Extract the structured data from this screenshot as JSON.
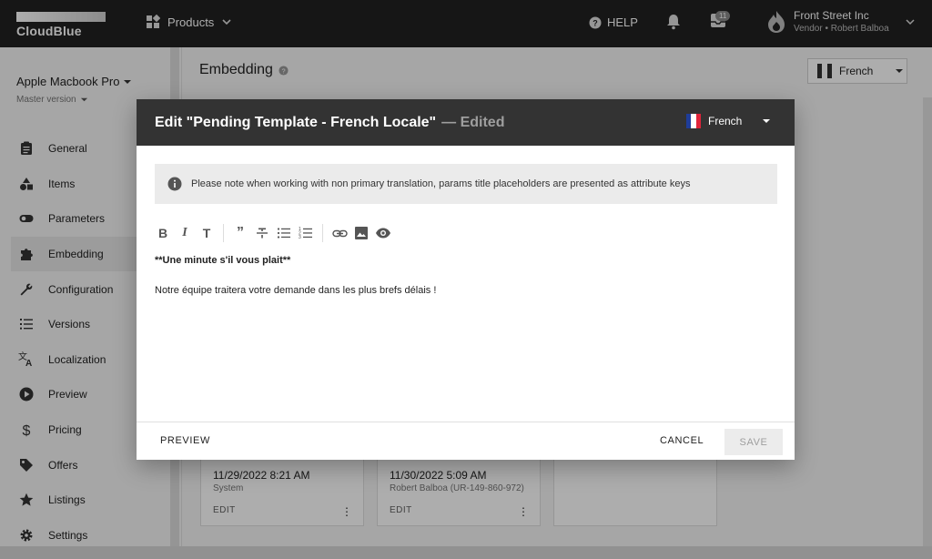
{
  "header": {
    "brand": "CloudBlue",
    "products_label": "Products",
    "help_label": "HELP",
    "inbox_badge": "11",
    "account_name": "Front Street Inc",
    "account_sub": "Vendor • Robert Balboa"
  },
  "sidebar": {
    "product_title": "Apple Macbook Pro",
    "product_version": "Master version",
    "items": [
      {
        "label": "General",
        "icon": "clipboard-icon"
      },
      {
        "label": "Items",
        "icon": "shapes-icon"
      },
      {
        "label": "Parameters",
        "icon": "toggle-icon"
      },
      {
        "label": "Embedding",
        "icon": "puzzle-icon"
      },
      {
        "label": "Configuration",
        "icon": "wrench-icon"
      },
      {
        "label": "Versions",
        "icon": "list-numbered-icon"
      },
      {
        "label": "Localization",
        "icon": "translate-icon"
      },
      {
        "label": "Preview",
        "icon": "play-circle-icon"
      },
      {
        "label": "Pricing",
        "icon": "dollar-icon"
      },
      {
        "label": "Offers",
        "icon": "tag-icon"
      },
      {
        "label": "Listings",
        "icon": "star-icon"
      },
      {
        "label": "Settings",
        "icon": "gear-icon"
      }
    ]
  },
  "main": {
    "title": "Embedding",
    "language": "French",
    "cards": [
      {
        "date": "11/29/2022 8:21 AM",
        "by": "System",
        "edit": "EDIT"
      },
      {
        "date": "11/30/2022 5:09 AM",
        "by": "Robert Balboa (UR-149-860-972)",
        "edit": "EDIT"
      }
    ]
  },
  "dialog": {
    "title": "Edit \"Pending Template - French Locale\"",
    "edited": "— Edited",
    "language": "French",
    "notice": "Please note when working with non primary translation, params title placeholders are presented as attribute keys",
    "content_bold": "**Une minute s'il vous plait**",
    "content_text": "Notre équipe traitera votre demande dans les plus brefs délais !",
    "preview_label": "PREVIEW",
    "cancel_label": "CANCEL",
    "save_label": "SAVE"
  },
  "colors": {
    "topbar": "#212121",
    "dialog_header": "#333333",
    "flag_blue": "#1f3d99",
    "flag_red": "#e0243a"
  }
}
